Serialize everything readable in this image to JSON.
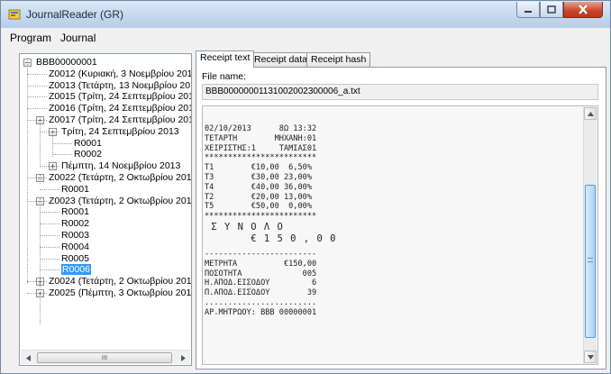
{
  "window": {
    "title": "JournalReader (GR)"
  },
  "menu": {
    "program": "Program",
    "journal": "Journal"
  },
  "tree": {
    "nodes": [
      {
        "label": "BBB00000001",
        "level": 0,
        "expander": "-"
      },
      {
        "label": "Z0012 (Κυριακή, 3 Νοεμβρίου 2013",
        "level": 1
      },
      {
        "label": "Z0013 (Τετάρτη, 13 Νοεμβρίου 20",
        "level": 1
      },
      {
        "label": "Z0015 (Τρίτη, 24 Σεπτεμβρίου 201",
        "level": 1
      },
      {
        "label": "Z0016 (Τρίτη, 24 Σεπτεμβρίου 201",
        "level": 1
      },
      {
        "label": "Z0017 (Τρίτη, 24 Σεπτεμβρίου 201",
        "level": 1,
        "expander": "-"
      },
      {
        "label": "Τρίτη, 24 Σεπτεμβρίου 2013",
        "level": 2,
        "expander": "-"
      },
      {
        "label": "R0001",
        "level": 3
      },
      {
        "label": "R0002",
        "level": 3
      },
      {
        "label": "Πέμπτη, 14 Νοεμβρίου 2013",
        "level": 2,
        "expander": "+"
      },
      {
        "label": "Z0022 (Τετάρτη, 2 Οκτωβρίου 201",
        "level": 1,
        "expander": "-"
      },
      {
        "label": "R0001",
        "level": 2
      },
      {
        "label": "Z0023 (Τετάρτη, 2 Οκτωβρίου 201",
        "level": 1,
        "expander": "-"
      },
      {
        "label": "R0001",
        "level": 2
      },
      {
        "label": "R0002",
        "level": 2
      },
      {
        "label": "R0003",
        "level": 2
      },
      {
        "label": "R0004",
        "level": 2
      },
      {
        "label": "R0005",
        "level": 2
      },
      {
        "label": "R0006",
        "level": 2,
        "selected": true
      },
      {
        "label": "Z0024 (Τετάρτη, 2 Οκτωβρίου 201",
        "level": 1,
        "expander": "+"
      },
      {
        "label": "Z0025 (Πέμπτη, 3 Οκτωβρίου 2013",
        "level": 1,
        "expander": "+"
      }
    ],
    "scroll_grip": "III"
  },
  "tabs": [
    {
      "label": "Receipt text",
      "active": true
    },
    {
      "label": "Receipt data",
      "active": false
    },
    {
      "label": "Receipt hash",
      "active": false
    }
  ],
  "file": {
    "label": "File name:",
    "value": "BBB00000001131002002300006_a.txt"
  },
  "receipt": {
    "lines": [
      {
        "text": "02/10/2013      8Ω 13:32"
      },
      {
        "text": "ΤΕΤΑΡΤΗ        ΜΗΧΑΝΗ:01"
      },
      {
        "text": "ΧΕΙΡΙΣΤΗΣ:1     ΤΑΜΙΑΣ01"
      },
      {
        "text": "************************"
      },
      {
        "text": "Τ1        €10,00  6,50%"
      },
      {
        "text": "Τ3        €30,00 23,00%"
      },
      {
        "text": "Τ4        €40,00 36,00%"
      },
      {
        "text": "Τ2        €20,00 13,00%"
      },
      {
        "text": "Τ5        €50,00  0,00%"
      },
      {
        "text": "************************"
      },
      {
        "text": " Σ Υ Ν Ο Λ Ο",
        "big": true
      },
      {
        "text": "       € 1 5 0 , 0 0",
        "big": true
      },
      {
        "text": "",
        "gap": true
      },
      {
        "text": "------------------------"
      },
      {
        "text": "ΜΕΤΡΗΤΑ          €150,00"
      },
      {
        "text": "ΠΟΣΟΤΗΤΑ             005"
      },
      {
        "text": "Η.ΑΠΟΔ.ΕΙΣΟΔΟΥ         6"
      },
      {
        "text": "Π.ΑΠΟΔ.ΕΙΣΟΔΟΥ        39"
      },
      {
        "text": "........................"
      },
      {
        "text": "ΑΡ.ΜΗΤΡΩΟΥ: BBB 00000001"
      }
    ]
  },
  "colors": {
    "selection": "#3399ff",
    "scroll_thumb": "#a9d3f5",
    "close_button": "#c9442a"
  }
}
